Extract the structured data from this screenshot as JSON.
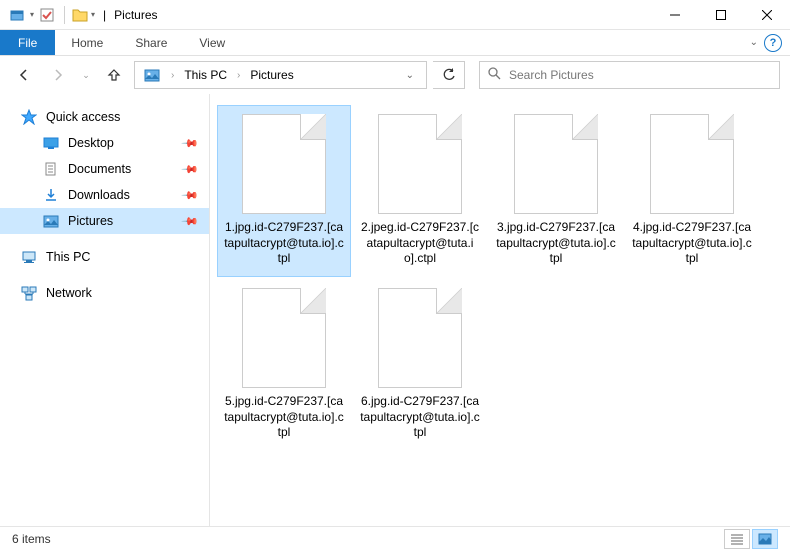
{
  "titlebar": {
    "separator": "|",
    "title": "Pictures"
  },
  "ribbon": {
    "file": "File",
    "tabs": [
      "Home",
      "Share",
      "View"
    ]
  },
  "breadcrumb": {
    "items": [
      "This PC",
      "Pictures"
    ]
  },
  "search": {
    "placeholder": "Search Pictures"
  },
  "sidebar": {
    "quick_access": "Quick access",
    "items": [
      {
        "label": "Desktop",
        "pinned": true
      },
      {
        "label": "Documents",
        "pinned": true
      },
      {
        "label": "Downloads",
        "pinned": true
      },
      {
        "label": "Pictures",
        "pinned": true,
        "selected": true
      }
    ],
    "this_pc": "This PC",
    "network": "Network"
  },
  "files": [
    {
      "name": "1.jpg.id-C279F237.[catapultacrypt@tuta.io].ctpl",
      "selected": true
    },
    {
      "name": "2.jpeg.id-C279F237.[catapultacrypt@tuta.io].ctpl"
    },
    {
      "name": "3.jpg.id-C279F237.[catapultacrypt@tuta.io].ctpl"
    },
    {
      "name": "4.jpg.id-C279F237.[catapultacrypt@tuta.io].ctpl"
    },
    {
      "name": "5.jpg.id-C279F237.[catapultacrypt@tuta.io].ctpl"
    },
    {
      "name": "6.jpg.id-C279F237.[catapultacrypt@tuta.io].ctpl"
    }
  ],
  "status": {
    "count": "6 items"
  }
}
